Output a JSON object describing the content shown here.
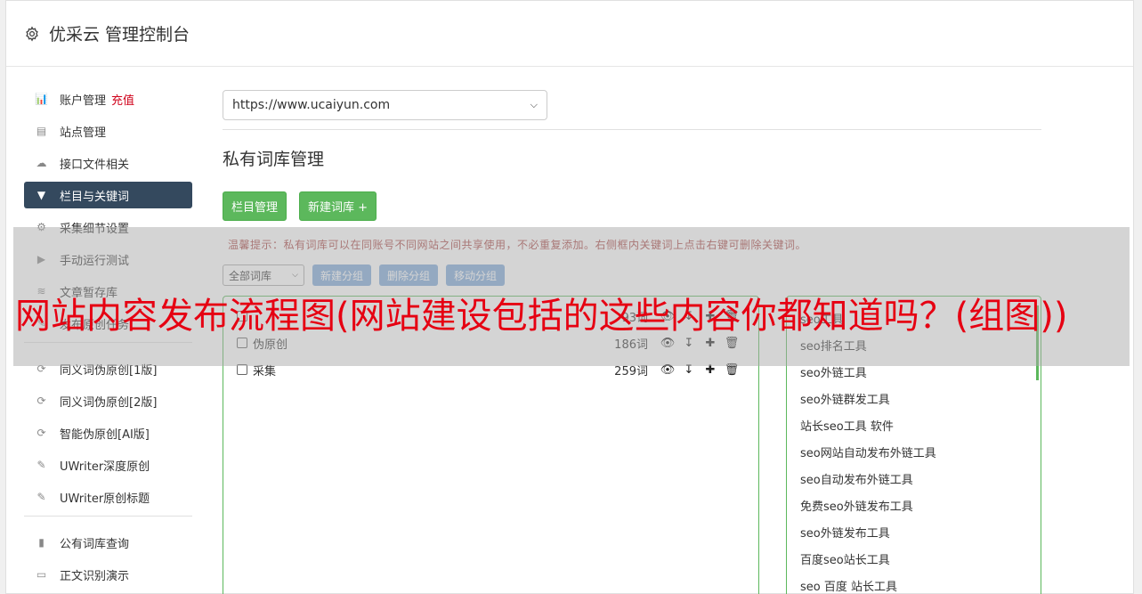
{
  "header": {
    "title": "优采云 管理控制台"
  },
  "sidebar": {
    "items": [
      {
        "icon": "bar-chart-icon",
        "glyph": "📊",
        "label": "账户管理",
        "extra": "充值"
      },
      {
        "icon": "server-icon",
        "glyph": "▤",
        "label": "站点管理"
      },
      {
        "icon": "cloud-upload-icon",
        "glyph": "☁",
        "label": "接口文件相关"
      },
      {
        "icon": "filter-icon",
        "glyph": "▼",
        "label": "栏目与关键词",
        "active": true
      },
      {
        "icon": "gears-icon",
        "glyph": "⚙",
        "label": "采集细节设置"
      },
      {
        "icon": "play-icon",
        "glyph": "▶",
        "label": "手动运行测试"
      },
      {
        "icon": "database-icon",
        "glyph": "≋",
        "label": "文章暂存库"
      },
      {
        "icon": "tasks-icon",
        "glyph": "✎",
        "label": "发布原创任务"
      }
    ],
    "items2": [
      {
        "icon": "refresh-icon",
        "glyph": "⟳",
        "label": "同义词伪原创[1版]"
      },
      {
        "icon": "refresh-icon",
        "glyph": "⟳",
        "label": "同义词伪原创[2版]"
      },
      {
        "icon": "refresh-icon",
        "glyph": "⟳",
        "label": "智能伪原创[AI版]"
      },
      {
        "icon": "edit-icon",
        "glyph": "✎",
        "label": "UWriter深度原创"
      },
      {
        "icon": "edit-icon",
        "glyph": "✎",
        "label": "UWriter原创标题"
      }
    ],
    "items3": [
      {
        "icon": "book-icon",
        "glyph": "▮",
        "label": "公有词库查询"
      },
      {
        "icon": "monitor-icon",
        "glyph": "▭",
        "label": "正文识别演示"
      }
    ]
  },
  "main": {
    "site_select": "https://www.ucaiyun.com",
    "section_title": "私有词库管理",
    "btn_columns": "栏目管理",
    "btn_new_lib": "新建词库 +",
    "tip": "温馨提示：私有词库可以在同账号不同网站之间共享使用，不必重复添加。右侧框内关键词上点击右键可删除关键词。",
    "lib_select": "全部词库",
    "btn_new_group": "新建分组",
    "btn_delete_group": "删除分组",
    "btn_move_group": "移动分组",
    "libraries": [
      {
        "name": "",
        "count": "93词"
      },
      {
        "name": "伪原创",
        "count": "186词"
      },
      {
        "name": "采集",
        "count": "259词"
      }
    ],
    "keywords": [
      "seo工具",
      "seo排名工具",
      "seo外链工具",
      "seo外链群发工具",
      "站长seo工具 软件",
      "seo网站自动发布外链工具",
      "seo自动发布外链工具",
      "免费seo外链发布工具",
      "seo外链发布工具",
      "百度seo站长工具",
      "seo 百度 站长工具"
    ]
  },
  "overlay": {
    "title": "网站内容发布流程图(网站建设包括的这些内容你都知道吗？(组图))"
  }
}
